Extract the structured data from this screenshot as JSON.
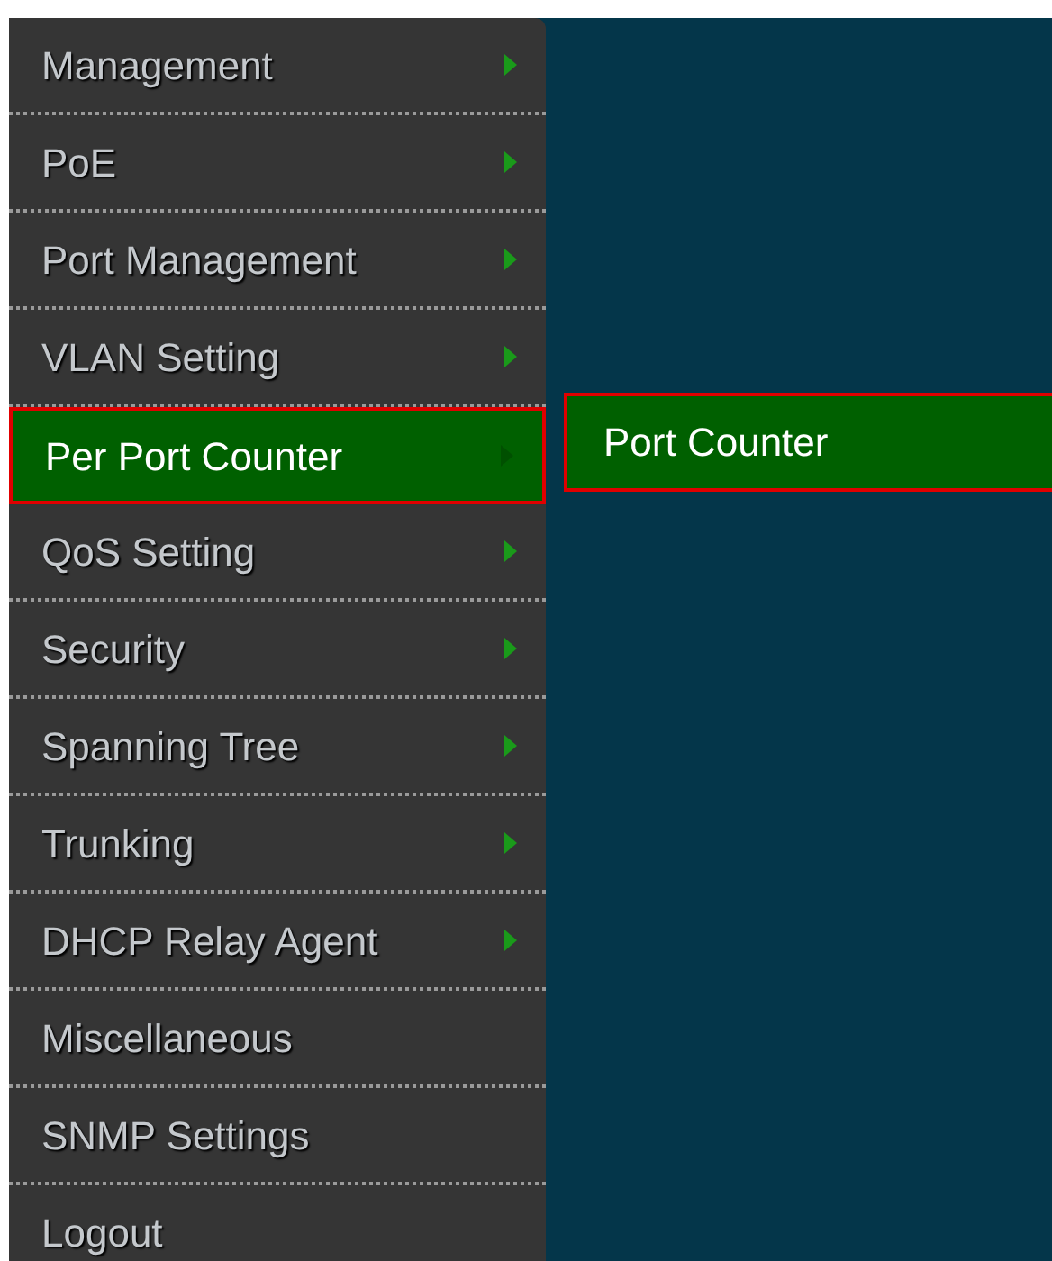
{
  "menu": [
    {
      "label": "Management",
      "has_submenu": true,
      "selected": false
    },
    {
      "label": "PoE",
      "has_submenu": true,
      "selected": false
    },
    {
      "label": "Port Management",
      "has_submenu": true,
      "selected": false
    },
    {
      "label": "VLAN Setting",
      "has_submenu": true,
      "selected": false
    },
    {
      "label": "Per Port Counter",
      "has_submenu": true,
      "selected": true
    },
    {
      "label": "QoS Setting",
      "has_submenu": true,
      "selected": false
    },
    {
      "label": "Security",
      "has_submenu": true,
      "selected": false
    },
    {
      "label": "Spanning Tree",
      "has_submenu": true,
      "selected": false
    },
    {
      "label": "Trunking",
      "has_submenu": true,
      "selected": false
    },
    {
      "label": "DHCP Relay Agent",
      "has_submenu": true,
      "selected": false
    },
    {
      "label": "Miscellaneous",
      "has_submenu": false,
      "selected": false
    },
    {
      "label": "SNMP Settings",
      "has_submenu": false,
      "selected": false
    },
    {
      "label": "Logout",
      "has_submenu": false,
      "selected": false
    }
  ],
  "submenu": [
    {
      "label": "Port Counter",
      "selected": true
    }
  ]
}
